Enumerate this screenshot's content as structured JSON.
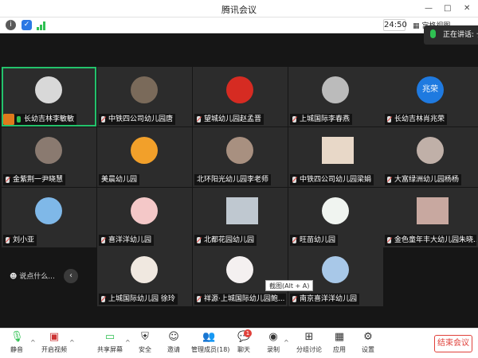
{
  "window": {
    "title": "腾讯会议",
    "controls": [
      "—",
      "□",
      "✕"
    ]
  },
  "infobar": {
    "timer": "24:50",
    "layout_label": "宫格视图",
    "network_icon": "signal-bars-icon"
  },
  "speaking": {
    "label": "正在讲话: 长"
  },
  "participants": [
    {
      "name": "长幼吉林李敏敏",
      "mic": "green",
      "host": true
    },
    {
      "name": "中铁四公司幼儿园唐",
      "mic": "red"
    },
    {
      "name": "望城幼儿园赵孟晋",
      "mic": "red"
    },
    {
      "name": "上城国际李春燕",
      "mic": "red"
    },
    {
      "name": "长幼吉林肖兆荣",
      "mic": "red",
      "avatar_text": "兆荣"
    },
    {
      "name": "金紫荆一尹晓慧",
      "mic": "red"
    },
    {
      "name": "美晨幼儿园",
      "mic": "none"
    },
    {
      "name": "北环阳光幼儿园李老师",
      "mic": "none"
    },
    {
      "name": "中铁四公司幼儿园梁娟",
      "mic": "red"
    },
    {
      "name": "大富绿洲幼儿园杨杨",
      "mic": "red"
    },
    {
      "name": "刘小亚",
      "mic": "red"
    },
    {
      "name": "喜洋洋幼儿园",
      "mic": "red"
    },
    {
      "name": "北都花园幼儿园",
      "mic": "red"
    },
    {
      "name": "旺苗幼儿园",
      "mic": "red"
    },
    {
      "name": "金色童年丰大幼儿园朱晓...",
      "mic": "red"
    },
    {
      "name": "上城国际幼儿园 徐玲",
      "mic": "red"
    },
    {
      "name": "祥源·上城国际幼儿园鲍...",
      "mic": "red"
    },
    {
      "name": "南京喜洋洋幼儿园",
      "mic": "red"
    }
  ],
  "chat": {
    "hint": "说点什么...",
    "arrow": "‹"
  },
  "tooltip": "截图(Alt + A)",
  "toolbar": {
    "mute": "静音",
    "video": "开启视频",
    "share": "共享屏幕",
    "security": "安全",
    "invite": "邀请",
    "members": "管理成员(18)",
    "chat": "聊天",
    "chat_badge": "1",
    "record": "录制",
    "breakout": "分组讨论",
    "apps": "应用",
    "settings": "设置",
    "end": "结束会议"
  }
}
